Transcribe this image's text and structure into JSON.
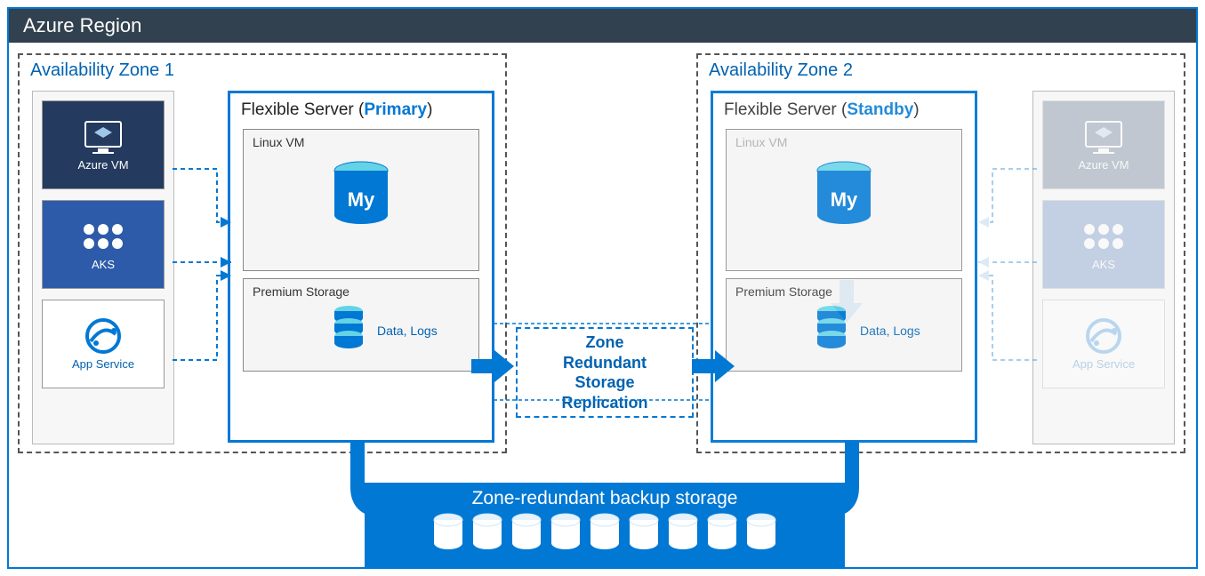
{
  "region": {
    "title": "Azure Region"
  },
  "az1": {
    "title": "Availability Zone 1",
    "services": {
      "vm": "Azure VM",
      "aks": "AKS",
      "appservice": "App Service"
    },
    "fs": {
      "title_prefix": "Flexible Server (",
      "role": "Primary",
      "title_suffix": ")",
      "vm": "Linux VM",
      "ps": "Premium Storage",
      "ps_data": "Data, Logs"
    }
  },
  "az2": {
    "title": "Availability Zone 2",
    "services": {
      "vm": "Azure VM",
      "aks": "AKS",
      "appservice": "App Service"
    },
    "fs": {
      "title_prefix": "Flexible Server (",
      "role": "Standby",
      "title_suffix": ")",
      "vm": "Linux VM",
      "ps": "Premium Storage",
      "ps_data": "Data, Logs"
    }
  },
  "zrs": {
    "l1": "Zone",
    "l2": "Redundant",
    "l3": "Storage",
    "l4": "Replication"
  },
  "backup": {
    "title": "Zone-redundant backup storage"
  }
}
